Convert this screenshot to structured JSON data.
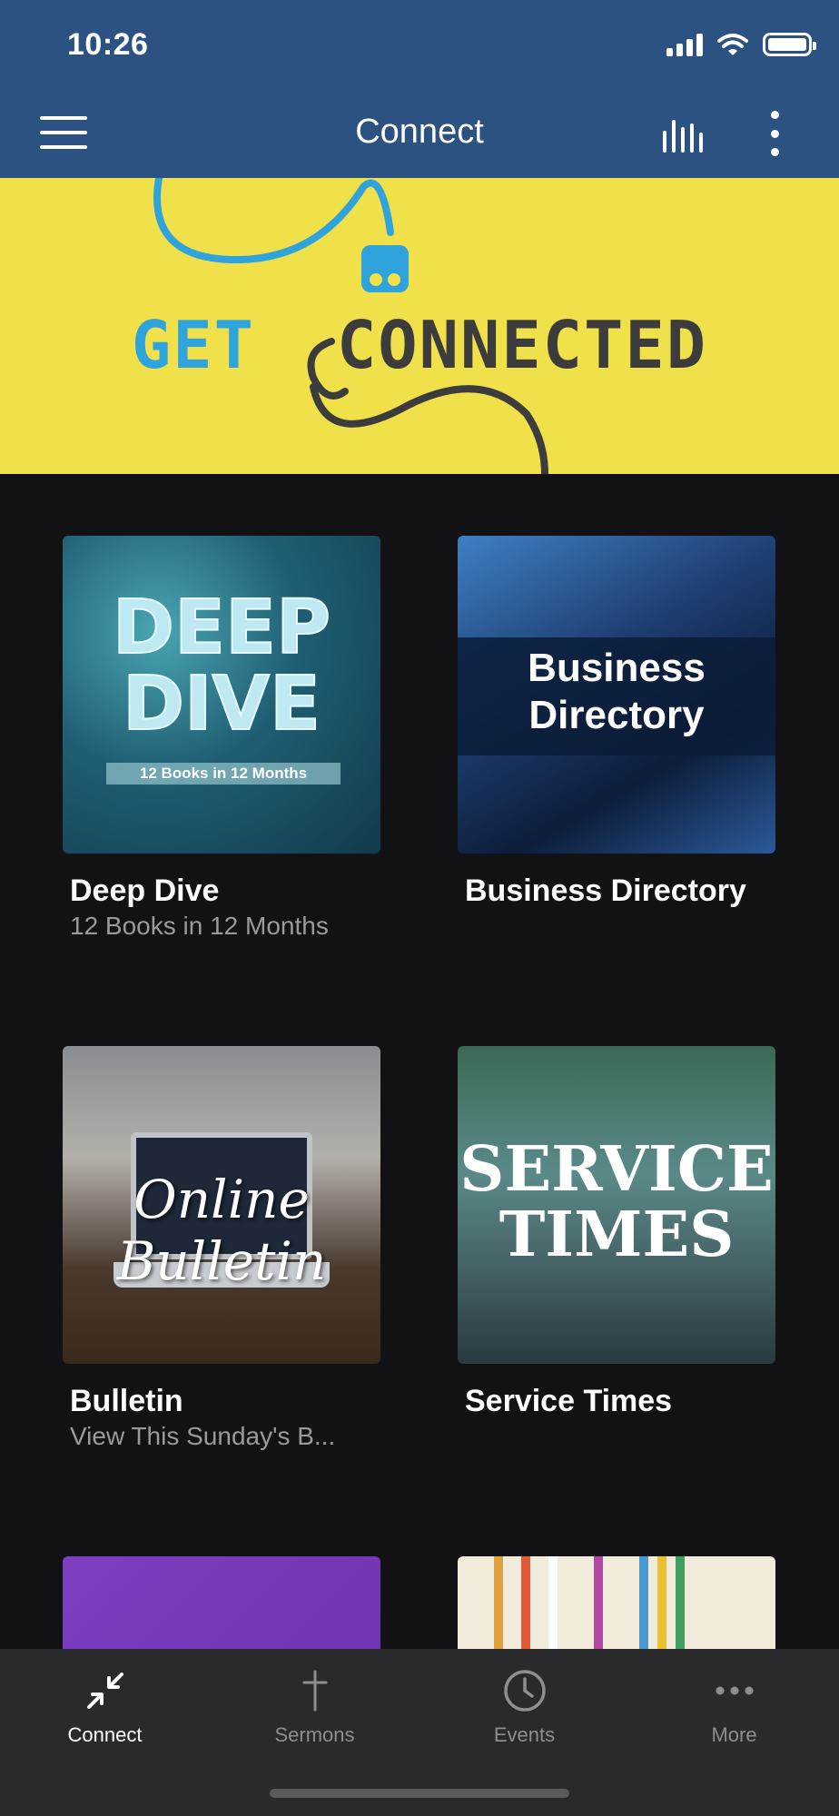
{
  "status": {
    "time": "10:26"
  },
  "header": {
    "title": "Connect"
  },
  "banner": {
    "text_left": "GET",
    "text_right": "CONNECTED"
  },
  "cards": [
    {
      "title": "Deep Dive",
      "subtitle": "12 Books in 12 Months",
      "thumb_title": "DEEP DIVE",
      "thumb_sub": "12 Books in 12 Months"
    },
    {
      "title": "Business Directory",
      "subtitle": "",
      "thumb_title": "Business Directory"
    },
    {
      "title": "Bulletin",
      "subtitle": "View This Sunday's B...",
      "thumb_title": "Online Bulletin"
    },
    {
      "title": "Service Times",
      "subtitle": "",
      "thumb_title": "SERVICE TIMES"
    }
  ],
  "tabs": [
    {
      "label": "Connect",
      "icon": "collapse-arrows-icon",
      "active": true
    },
    {
      "label": "Sermons",
      "icon": "cross-icon",
      "active": false
    },
    {
      "label": "Events",
      "icon": "clock-icon",
      "active": false
    },
    {
      "label": "More",
      "icon": "more-dots-icon",
      "active": false
    }
  ],
  "colors": {
    "header": "#2b5280",
    "banner": "#f0e04a",
    "background": "#121214",
    "tabbar": "#2a2a2c"
  }
}
